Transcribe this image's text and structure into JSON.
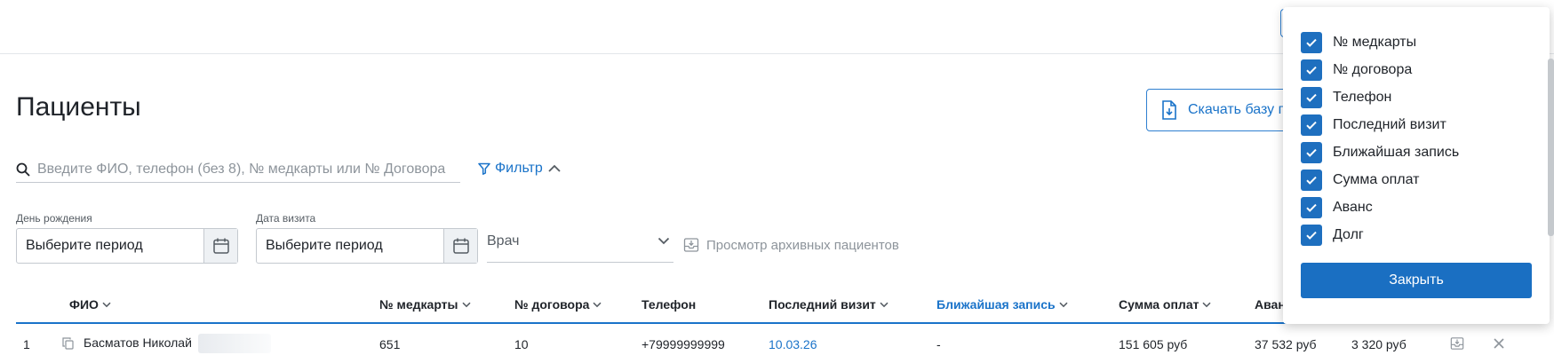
{
  "page": {
    "title": "Пациенты"
  },
  "toolbar": {
    "download_label": "Скачать базу па"
  },
  "search": {
    "placeholder": "Введите ФИО, телефон (без 8), № медкарты или № Договора",
    "value": ""
  },
  "filter": {
    "label": "Фильтр"
  },
  "filters": {
    "birthday": {
      "label": "День рождения",
      "value": "Выберите период"
    },
    "visit_date": {
      "label": "Дата визита",
      "value": "Выберите период"
    },
    "doctor": {
      "placeholder": "Врач"
    },
    "archive_label": "Просмотр архивных пациентов"
  },
  "table": {
    "columns": [
      "ФИО",
      "№ медкарты",
      "№ договора",
      "Телефон",
      "Последний визит",
      "Ближайшая запись",
      "Сумма оплат",
      "Аван"
    ],
    "rows": [
      {
        "index": "1",
        "name": "Басматов Николай",
        "card": "651",
        "contract": "10",
        "phone": "+79999999999",
        "last_visit": "10.03.26",
        "next_record": "-",
        "payments": "151 605 руб",
        "advance": "37 532 руб",
        "debt": "3 320 руб"
      }
    ]
  },
  "column_menu": {
    "options": [
      "№ медкарты",
      "№ договора",
      "Телефон",
      "Последний визит",
      "Ближайшая запись",
      "Сумма оплат",
      "Аванс",
      "Долг"
    ],
    "close_label": "Закрыть"
  },
  "colors": {
    "accent": "#1a73c9",
    "checkbox": "#1e6fbf",
    "button": "#1a6fc2"
  }
}
